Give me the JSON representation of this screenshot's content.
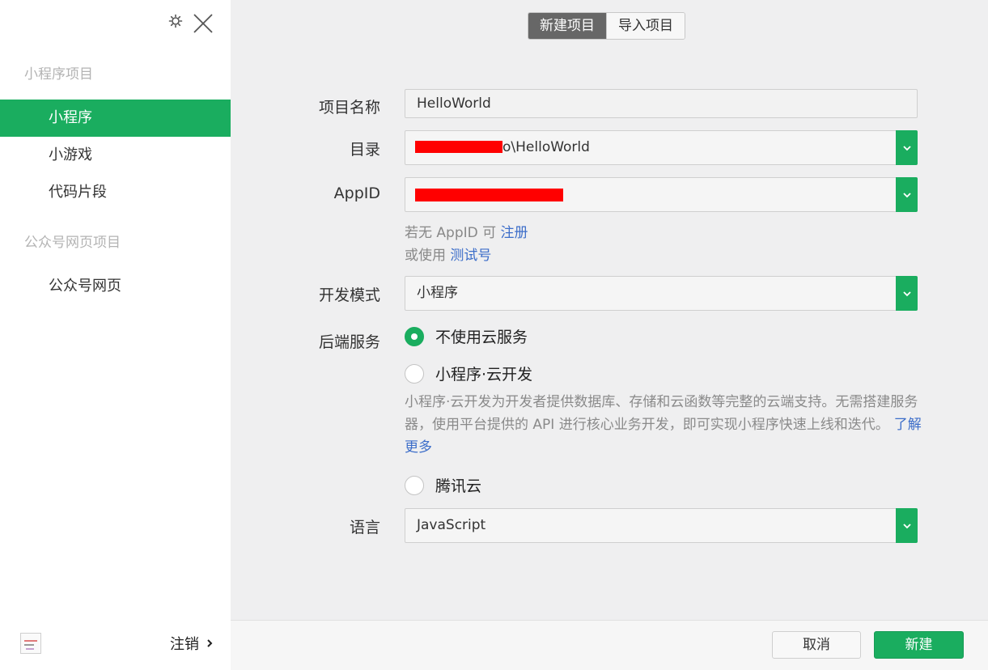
{
  "sidebar": {
    "section_miniprogram": "小程序项目",
    "items_miniprogram": [
      {
        "label": "小程序",
        "active": true
      },
      {
        "label": "小游戏",
        "active": false
      },
      {
        "label": "代码片段",
        "active": false
      }
    ],
    "section_official": "公众号网页项目",
    "items_official": [
      {
        "label": "公众号网页",
        "active": false
      }
    ],
    "logout_label": "注销"
  },
  "tabs": {
    "new_project": "新建项目",
    "import_project": "导入项目"
  },
  "form": {
    "project_name": {
      "label": "项目名称",
      "value": "HelloWorld"
    },
    "directory": {
      "label": "目录",
      "value_suffix": "o\\HelloWorld"
    },
    "appid": {
      "label": "AppID"
    },
    "appid_hint": {
      "prefix": "若无 AppID 可",
      "register_link": "注册"
    },
    "testid_hint": {
      "prefix": "或使用",
      "test_link": "测试号"
    },
    "dev_mode": {
      "label": "开发模式",
      "value": "小程序"
    },
    "backend": {
      "label": "后端服务",
      "options": [
        {
          "label": "不使用云服务",
          "checked": true
        },
        {
          "label": "小程序·云开发",
          "checked": false
        },
        {
          "label": "腾讯云",
          "checked": false
        }
      ],
      "description": "小程序·云开发为开发者提供数据库、存储和云函数等完整的云端支持。无需搭建服务器，使用平台提供的 API 进行核心业务开发，即可实现小程序快速上线和迭代。",
      "learn_more": "了解更多"
    },
    "language": {
      "label": "语言",
      "value": "JavaScript"
    }
  },
  "footer": {
    "cancel_label": "取消",
    "create_label": "新建"
  },
  "colors": {
    "accent": "#1aad5f",
    "link": "#3d6ec9",
    "redaction": "#ff0000"
  },
  "icons": [
    "gear-icon",
    "close-icon",
    "chevron-down-icon",
    "chevron-right-icon",
    "avatar"
  ]
}
